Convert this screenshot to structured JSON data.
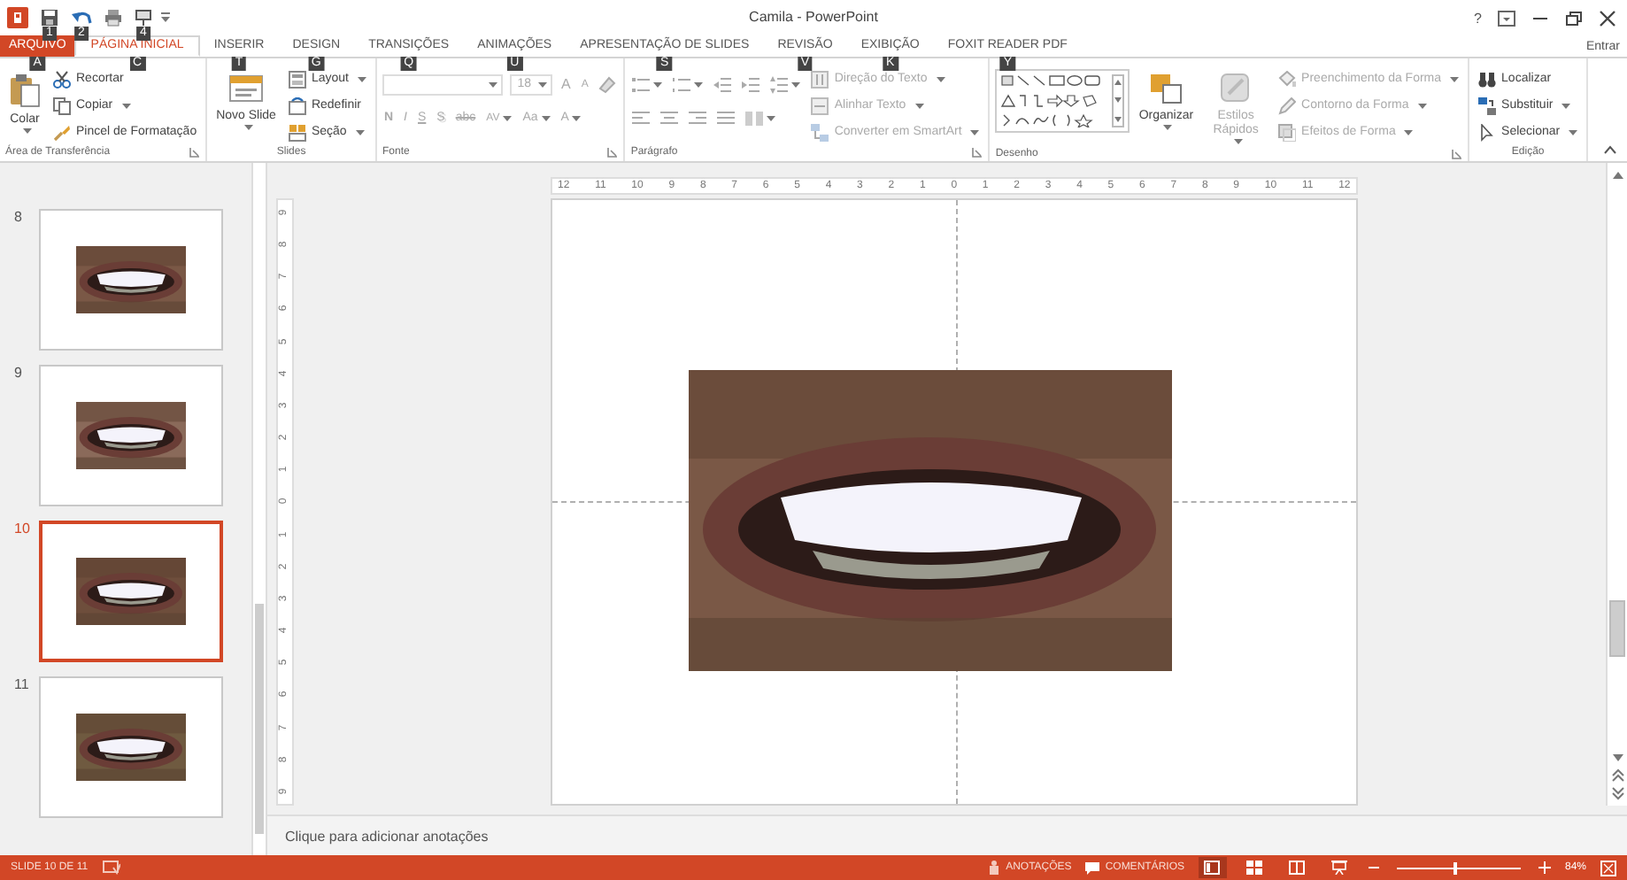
{
  "title": "Camila - PowerPoint",
  "quick_access": [
    {
      "kind": "logo"
    },
    {
      "kind": "save",
      "key_tip": "1"
    },
    {
      "kind": "undo",
      "key_tip": "2"
    },
    {
      "kind": "print"
    },
    {
      "kind": "present",
      "key_tip": "4"
    }
  ],
  "help": "?",
  "account": "Entrar",
  "tabs": [
    {
      "label": "ARQUIVO",
      "kind": "file",
      "selected": false,
      "key_tip": "A"
    },
    {
      "label": "PÁGINA INICIAL",
      "kind": "tab",
      "selected": true,
      "key_tip": "C"
    },
    {
      "label": "INSERIR",
      "kind": "tab",
      "selected": false,
      "key_tip": "T"
    },
    {
      "label": "DESIGN",
      "kind": "tab",
      "selected": false,
      "key_tip": "G"
    },
    {
      "label": "TRANSIÇÕES",
      "kind": "tab",
      "selected": false,
      "key_tip": "Q"
    },
    {
      "label": "ANIMAÇÕES",
      "kind": "tab",
      "selected": false,
      "key_tip": "U"
    },
    {
      "label": "APRESENTAÇÃO DE SLIDES",
      "kind": "tab",
      "selected": false,
      "key_tip": "S"
    },
    {
      "label": "REVISÃO",
      "kind": "tab",
      "selected": false,
      "key_tip": "V"
    },
    {
      "label": "EXIBIÇÃO",
      "kind": "tab",
      "selected": false,
      "key_tip": "K"
    },
    {
      "label": "FOXIT READER PDF",
      "kind": "tab",
      "selected": false,
      "key_tip": "Y"
    }
  ],
  "ribbon_groups": [
    {
      "kind": "clipboard",
      "label": "Área de Transferência",
      "large": [
        {
          "label": "Colar",
          "disabled": false
        }
      ],
      "small": [
        {
          "label": "Recortar",
          "disabled": false
        },
        {
          "label": "Copiar",
          "disabled": false
        },
        {
          "label": "Pincel de Formatação",
          "disabled": false
        }
      ]
    },
    {
      "kind": "slides",
      "label": "Slides",
      "large": [
        {
          "label": "Novo Slide",
          "disabled": false
        }
      ],
      "small": [
        {
          "label": "Layout",
          "disabled": false
        },
        {
          "label": "Redefinir",
          "disabled": false
        },
        {
          "label": "Seção",
          "disabled": false
        }
      ]
    },
    {
      "kind": "font",
      "label": "Fonte",
      "font_size": {
        "value": "18",
        "disabled": true
      },
      "buttons": [
        {
          "label": "A",
          "disabled": true
        },
        {
          "label": "A",
          "disabled": true
        },
        {
          "label": "N",
          "disabled": true
        },
        {
          "label": "I",
          "disabled": true
        },
        {
          "label": "S",
          "disabled": true
        },
        {
          "label": "S",
          "disabled": true
        },
        {
          "label": "abc",
          "disabled": true
        },
        {
          "label": "AV",
          "disabled": true
        },
        {
          "label": "Aa",
          "disabled": true
        },
        {
          "label": "A",
          "disabled": true
        }
      ]
    },
    {
      "kind": "paragraph",
      "label": "Parágrafo",
      "small": [
        {
          "label": "Direção do Texto",
          "disabled": true
        },
        {
          "label": "Alinhar Texto",
          "disabled": true
        },
        {
          "label": "Converter em SmartArt",
          "disabled": true
        }
      ]
    },
    {
      "kind": "drawing",
      "label": "Desenho",
      "large": [
        {
          "label": "Organizar",
          "disabled": false
        },
        {
          "label": "Estilos Rápidos",
          "disabled": true
        }
      ],
      "small": [
        {
          "label": "Preenchimento da Forma",
          "disabled": true
        },
        {
          "label": "Contorno da Forma",
          "disabled": true
        },
        {
          "label": "Efeitos de Forma",
          "disabled": true
        }
      ]
    },
    {
      "kind": "editing",
      "label": "Edição",
      "small": [
        {
          "label": "Localizar",
          "disabled": false
        },
        {
          "label": "Substituir",
          "disabled": false
        },
        {
          "label": "Selecionar",
          "disabled": false
        }
      ]
    }
  ],
  "slides": [
    {
      "number": "8",
      "selected": false
    },
    {
      "number": "9",
      "selected": false
    },
    {
      "number": "10",
      "selected": true
    },
    {
      "number": "11",
      "selected": false
    }
  ],
  "ruler": {
    "horizontal": [
      "12",
      "11",
      "10",
      "9",
      "8",
      "7",
      "6",
      "5",
      "4",
      "3",
      "2",
      "1",
      "0",
      "1",
      "2",
      "3",
      "4",
      "5",
      "6",
      "7",
      "8",
      "9",
      "10",
      "11",
      "12"
    ],
    "vertical": [
      "9",
      "8",
      "7",
      "6",
      "5",
      "4",
      "3",
      "2",
      "1",
      "0",
      "1",
      "2",
      "3",
      "4",
      "5",
      "6",
      "7",
      "8",
      "9"
    ]
  },
  "notes": {
    "placeholder": "Clique para adicionar anotações"
  },
  "status_bar": {
    "slide_info": "SLIDE 10 DE 11",
    "notes": "ANOTAÇÕES",
    "comments": "COMENTÁRIOS",
    "views": [
      {
        "kind": "normal",
        "selected": true
      },
      {
        "kind": "sorter",
        "selected": false
      },
      {
        "kind": "reading",
        "selected": false
      },
      {
        "kind": "slideshow",
        "selected": false
      }
    ],
    "zoom": {
      "level": 0.47,
      "label": "84%"
    }
  }
}
